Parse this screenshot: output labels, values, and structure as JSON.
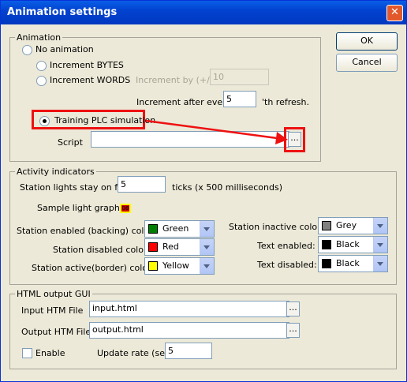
{
  "window": {
    "title": "Animation settings",
    "close_glyph": "✕"
  },
  "buttons": {
    "ok": "OK",
    "cancel": "Cancel"
  },
  "animation": {
    "legend": "Animation",
    "no_animation": "No animation",
    "increment_bytes": "Increment BYTES",
    "increment_words": "Increment WORDS",
    "increment_by_label": "Increment by (+/-)",
    "increment_by_value": "10",
    "increment_after_label": "Increment after every",
    "increment_after_value": "5",
    "refresh_suffix": "'th refresh.",
    "training_plc": "Training PLC simulation",
    "script_label": "Script",
    "script_value": "",
    "browse": "...",
    "selected": "Training PLC simulation"
  },
  "activity": {
    "legend": "Activity indicators",
    "lights_label": "Station lights stay on for",
    "lights_value": "5",
    "ticks_label": "ticks (x 500 milliseconds)",
    "sample_label": "Sample light graphic",
    "sample_text": "08",
    "enabled_label": "Station enabled (backing) color:",
    "enabled_value": "Green",
    "enabled_color": "#008000",
    "disabled_label": "Station disabled color:",
    "disabled_value": "Red",
    "disabled_color": "#ff0000",
    "active_label": "Station active(border) color:",
    "active_value": "Yellow",
    "active_color": "#ffff00",
    "inactive_label": "Station inactive color:",
    "inactive_value": "Grey",
    "inactive_color": "#808080",
    "text_enabled_label": "Text enabled:",
    "text_enabled_value": "Black",
    "text_enabled_color": "#000000",
    "text_disabled_label": "Text disabled:",
    "text_disabled_value": "Black",
    "text_disabled_color": "#000000"
  },
  "html_output": {
    "legend": "HTML output GUI",
    "input_label": "Input HTM File",
    "input_value": "input.html",
    "output_label": "Output HTM File",
    "output_value": "output.html",
    "enable_label": "Enable",
    "update_label": "Update rate (sec)",
    "update_value": "5",
    "browse": "..."
  }
}
